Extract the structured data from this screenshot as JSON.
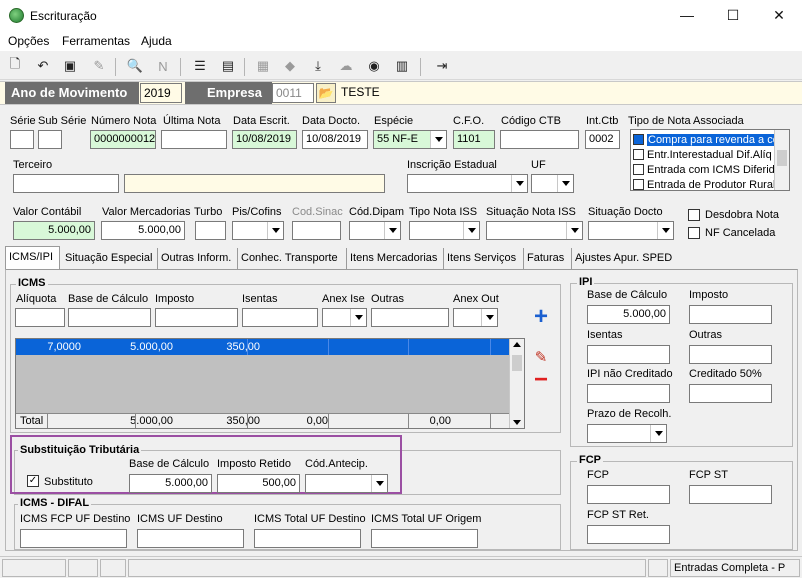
{
  "window": {
    "title": "Escrituração",
    "minimize": "—",
    "maximize": "☐",
    "close": "✕"
  },
  "menu": {
    "items": [
      "Opções",
      "Ferramentas",
      "Ajuda"
    ]
  },
  "header": {
    "ano_label": "Ano de Movimento",
    "ano_value": "2019",
    "empresa_label": "Empresa",
    "empresa_code": "0011",
    "empresa_name": "TESTE"
  },
  "form": {
    "serie_label": "Série",
    "sub_serie_label": "Sub Série",
    "numero_nota_label": "Número Nota",
    "numero_nota_value": "0000000012",
    "ultima_nota_label": "Última Nota",
    "data_escrit_label": "Data Escrit.",
    "data_escrit_value": "10/08/2019",
    "data_docto_label": "Data Docto.",
    "data_docto_value": "10/08/2019",
    "especie_label": "Espécie",
    "especie_value": "55  NF-E",
    "cfo_label": "C.F.O.",
    "cfo_value": "1101",
    "codigo_ctb_label": "Código CTB",
    "int_ctb_label": "Int.Ctb",
    "int_ctb_value": "0002",
    "tipo_nota_label": "Tipo de Nota Associada",
    "tipo_nota_items": [
      "Compra para revenda a co",
      "Entr.Interestadual Dif.Alíq",
      "Entrada com ICMS Diferido",
      "Entrada de Produtor Rural"
    ],
    "terceiro_label": "Terceiro",
    "inscricao_label": "Inscrição Estadual",
    "uf_label": "UF",
    "valor_contabil_label": "Valor Contábil",
    "valor_contabil_value": "5.000,00",
    "valor_mercadorias_label": "Valor Mercadorias",
    "valor_mercadorias_value": "5.000,00",
    "turbo_label": "Turbo",
    "pis_cofins_label": "Pis/Cofins",
    "cod_sinac_label": "Cod.Sinac",
    "cod_dipam_label": "Cód.Dipam",
    "tipo_nota_iss_label": "Tipo Nota ISS",
    "situacao_nota_iss_label": "Situação Nota ISS",
    "situacao_docto_label": "Situação Docto",
    "desdobra_label": "Desdobra Nota",
    "nf_cancelada_label": "NF Cancelada"
  },
  "tabs": [
    "ICMS/IPI",
    "Situação Especial",
    "Outras Inform.",
    "Conhec. Transporte",
    "Itens Mercadorias",
    "Itens Serviços",
    "Faturas",
    "Ajustes Apur. SPED"
  ],
  "icms": {
    "title": "ICMS",
    "aliquota_label": "Alíquota",
    "base_label": "Base de Cálculo",
    "imposto_label": "Imposto",
    "isentas_label": "Isentas",
    "anex_ise_label": "Anex Ise",
    "outras_label": "Outras",
    "anex_out_label": "Anex Out",
    "row": {
      "aliquota": "7,0000",
      "base": "5.000,00",
      "imposto": "350,00"
    },
    "total": {
      "label": "Total",
      "base": "5.000,00",
      "imposto": "350,00",
      "isentas": "0,00",
      "outras": "0,00"
    }
  },
  "st": {
    "title": "Substituição Tributária",
    "substituto_label": "Substituto",
    "substituto_checked": "✓",
    "base_label": "Base de Cálculo",
    "base_value": "5.000,00",
    "imposto_label": "Imposto Retido",
    "imposto_value": "500,00",
    "cod_antecip_label": "Cód.Antecip."
  },
  "difal": {
    "title": "ICMS - DIFAL",
    "fcp_uf_label": "ICMS FCP UF Destino",
    "uf_destino_label": "ICMS UF Destino",
    "total_destino_label": "ICMS Total UF Destino",
    "total_origem_label": "ICMS Total UF Origem"
  },
  "ipi": {
    "title": "IPI",
    "base_label": "Base de Cálculo",
    "base_value": "5.000,00",
    "imposto_label": "Imposto",
    "isentas_label": "Isentas",
    "outras_label": "Outras",
    "nao_creditado_label": "IPI não Creditado",
    "creditado_label": "Creditado 50%",
    "prazo_label": "Prazo de Recolh."
  },
  "fcp": {
    "title": "FCP",
    "fcp_label": "FCP",
    "fcp_st_label": "FCP ST",
    "fcp_st_ret_label": "FCP ST Ret."
  },
  "status": {
    "mode": "Entradas Completa - P"
  },
  "colors": {
    "accent": "#0a64d8",
    "highlight_border": "#9b4fa3",
    "header_bg": "#6e6e6e"
  }
}
